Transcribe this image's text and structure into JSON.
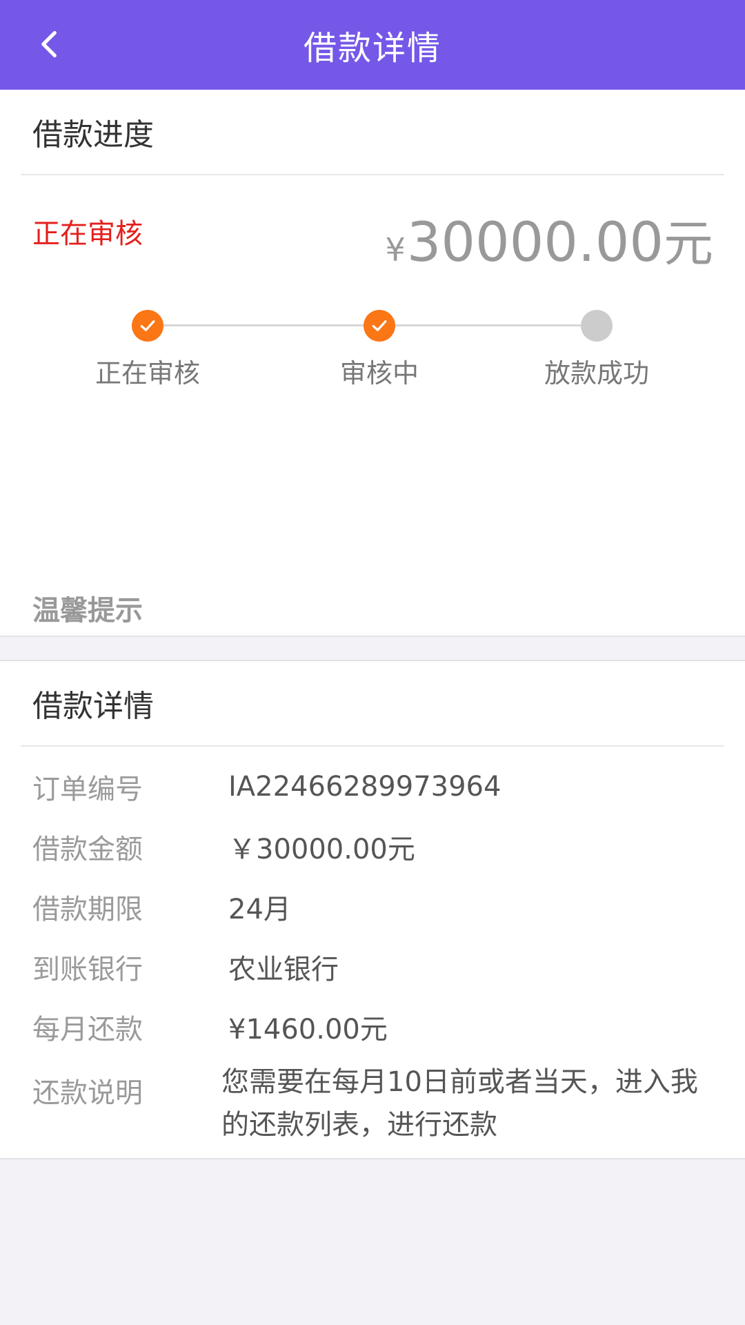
{
  "header": {
    "title": "借款详情"
  },
  "progress": {
    "section_title": "借款进度",
    "status": "正在审核",
    "amount": {
      "currency": "¥",
      "number": "30000.00",
      "unit": "元"
    },
    "steps": [
      {
        "label": "正在审核",
        "done": true
      },
      {
        "label": "审核中",
        "done": true
      },
      {
        "label": "放款成功",
        "done": false
      }
    ],
    "tip_title": "温馨提示"
  },
  "details": {
    "section_title": "借款详情",
    "rows": [
      {
        "label": "订单编号",
        "value": "IA22466289973964"
      },
      {
        "label": "借款金额",
        "value": "￥30000.00元"
      },
      {
        "label": "借款期限",
        "value": "24月"
      },
      {
        "label": "到账银行",
        "value": "农业银行"
      },
      {
        "label": "每月还款",
        "value": "¥1460.00元"
      },
      {
        "label": "还款说明",
        "value": "您需要在每月10日前或者当天，进入我的还款列表，进行还款"
      }
    ]
  },
  "colors": {
    "header_bg": "#7558e8",
    "status_red": "#e3201d",
    "step_done": "#fb7615",
    "step_todo": "#cccccc"
  }
}
